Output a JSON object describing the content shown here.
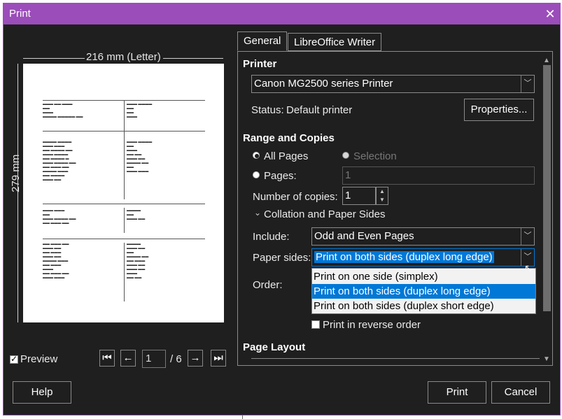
{
  "window": {
    "title": "Print"
  },
  "preview": {
    "width_label": "216 mm (Letter)",
    "height_label": "279 mm",
    "show_preview_label": "Preview",
    "page_current": "1",
    "page_total": "/ 6"
  },
  "tabs": [
    "General",
    "LibreOffice Writer"
  ],
  "printer": {
    "heading": "Printer",
    "selected": "Canon MG2500 series Printer",
    "status_label": "Status:",
    "status_value": "Default printer",
    "properties_label": "Properties..."
  },
  "range": {
    "heading": "Range and Copies",
    "all_pages": "All Pages",
    "selection": "Selection",
    "pages_label": "Pages:",
    "pages_value": "1",
    "copies_label": "Number of copies:",
    "copies_value": "1",
    "collation_label": "Collation and Paper Sides",
    "include_label": "Include:",
    "include_value": "Odd and Even Pages",
    "paper_sides_label": "Paper sides:",
    "paper_sides_value": "Print on both sides (duplex long edge)",
    "order_label": "Order:",
    "reverse_label": "Print in reverse order"
  },
  "paper_sides_options": [
    "Print on one side (simplex)",
    "Print on both sides (duplex long edge)",
    "Print on both sides (duplex short edge)"
  ],
  "page_layout": {
    "heading": "Page Layout"
  },
  "buttons": {
    "help": "Help",
    "print": "Print",
    "cancel": "Cancel"
  },
  "colors": {
    "accent": "#9b4dba",
    "highlight": "#0078d7",
    "dialog_bg": "#1f1f1f"
  }
}
